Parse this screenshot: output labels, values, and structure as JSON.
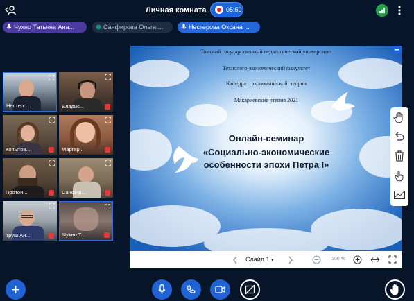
{
  "header": {
    "title": "Личная комната",
    "timer": "05:50"
  },
  "participants_pills": [
    {
      "name": "Чухно Татьяна Ана..."
    },
    {
      "name": "Санфирова Ольга ..."
    },
    {
      "name": "Нестерова Оксана ..."
    }
  ],
  "video_tiles": [
    {
      "name": "Нестеро..."
    },
    {
      "name": "Владис..."
    },
    {
      "name": "Копытов..."
    },
    {
      "name": "Маргар..."
    },
    {
      "name": "Протои..."
    },
    {
      "name": "Санфир..."
    },
    {
      "name": "Труш Ан..."
    },
    {
      "name": "Чухно Т..."
    }
  ],
  "slide": {
    "line1": "Томский государственный педагогический университет",
    "line2": "Технолого-экономический факультет",
    "line3": "Кафедра    экономической  теории",
    "line4": "Макариевские чтения 2021",
    "heading1": "Онлайн-семинар",
    "heading2": "«Социально-экономические",
    "heading3": "особенности эпохи Петра I»"
  },
  "slide_controls": {
    "slide_label": "Слайд 1",
    "zoom": "100 %"
  },
  "icons": {
    "back": "person-back-icon",
    "signal": "signal-icon",
    "more": "more-vert-icon"
  },
  "colors": {
    "background": "#06152a",
    "accent": "#2566d8",
    "record": "#e5222f"
  }
}
